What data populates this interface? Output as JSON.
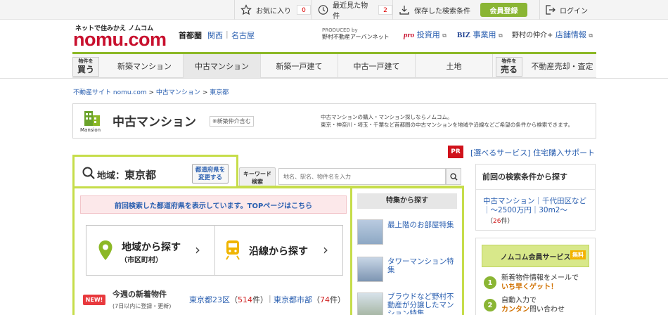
{
  "topbar": {
    "favorites_label": "お気に入り",
    "favorites_count": "0",
    "recent_label": "最近見た物件",
    "recent_count": "2",
    "saved_search_label": "保存した検索条件",
    "member_register": "会員登録",
    "login": "ログイン"
  },
  "header": {
    "tagline": "ネットで住みかえ ノムコム",
    "logo": "nomu.com",
    "regions": [
      "首都圏",
      "関西",
      "名古屋"
    ],
    "produced_by": "PRODUCED by",
    "produced_company": "野村不動産アーバンネット",
    "links": {
      "pro_prefix": "pro",
      "pro_label": "投資用",
      "biz_prefix": "BIZ",
      "biz_label": "事業用",
      "store_prefix": "野村の仲介+",
      "store_label": "店舗情報"
    }
  },
  "nav": {
    "buy_badge_small": "物件を",
    "buy_badge_big": "買う",
    "items": [
      "新築マンション",
      "中古マンション",
      "新築一戸建て",
      "中古一戸建て",
      "土地"
    ],
    "sell_badge_small": "物件を",
    "sell_badge_big": "売る",
    "sell_item": "不動産売却・査定"
  },
  "breadcrumb": [
    "不動産サイト nomu.com",
    "中古マンション",
    "東京都"
  ],
  "banner": {
    "icon_caption": "Mansion",
    "title": "中古マンション",
    "note": "※新築仲介含む",
    "desc_line1": "中古マンションの購入・マンション探しならノムコム。",
    "desc_line2": "東京・神奈川・埼玉・千葉など首都圏の中古マンションを地域や沿線などご希望の条件から検索できます。"
  },
  "pr": {
    "badge": "PR",
    "text": "[選べるサービス] 住宅購入サポート"
  },
  "area": {
    "label": "地域",
    "sep": "：",
    "value": "東京都",
    "change_button_line1": "都道府県を",
    "change_button_line2": "変更する"
  },
  "keyword": {
    "label_line1": "キーワード",
    "label_line2": "検索",
    "placeholder": "地名、駅名、物件名を入力"
  },
  "notice": "前回検索した都道府県を表示しています。TOPページはこちら",
  "search_by_area": {
    "title": "地域から探す",
    "sub": "（市区町村）"
  },
  "search_by_line": {
    "title": "沿線から探す"
  },
  "tokushu": {
    "heading": "特集から探す",
    "items": [
      "最上階のお部屋特集",
      "タワーマンション特集",
      "ブラウドなど野村不動産が分譲したマンション特集"
    ]
  },
  "new_listings": {
    "badge": "NEW!",
    "title": "今週の新着物件",
    "sub": "(7日以内に登録・更新)",
    "links": [
      {
        "label": "東京都23区",
        "count": "514"
      },
      {
        "label": "東京都市部",
        "count": "74"
      }
    ],
    "count_suffix": "件"
  },
  "previous_search": {
    "title": "前回の検索条件から探す",
    "link": "中古マンション｜千代田区など｜～2500万円｜30m2～",
    "count": "26"
  },
  "member_service": {
    "title": "ノムコム会員サービス",
    "free": "無料",
    "items": [
      {
        "num": "1",
        "line1": "新着物件情報をメールで",
        "highlight": "いち早くゲット！"
      },
      {
        "num": "2",
        "line1": "自動入力で",
        "highlight": "カンタン",
        "rest": "問い合わせ"
      }
    ]
  },
  "colors": {
    "accent_green": "#8cb826",
    "frame_green": "#c6dd4a",
    "brand_red": "#c8102e",
    "link_blue": "#2a5fb0"
  }
}
